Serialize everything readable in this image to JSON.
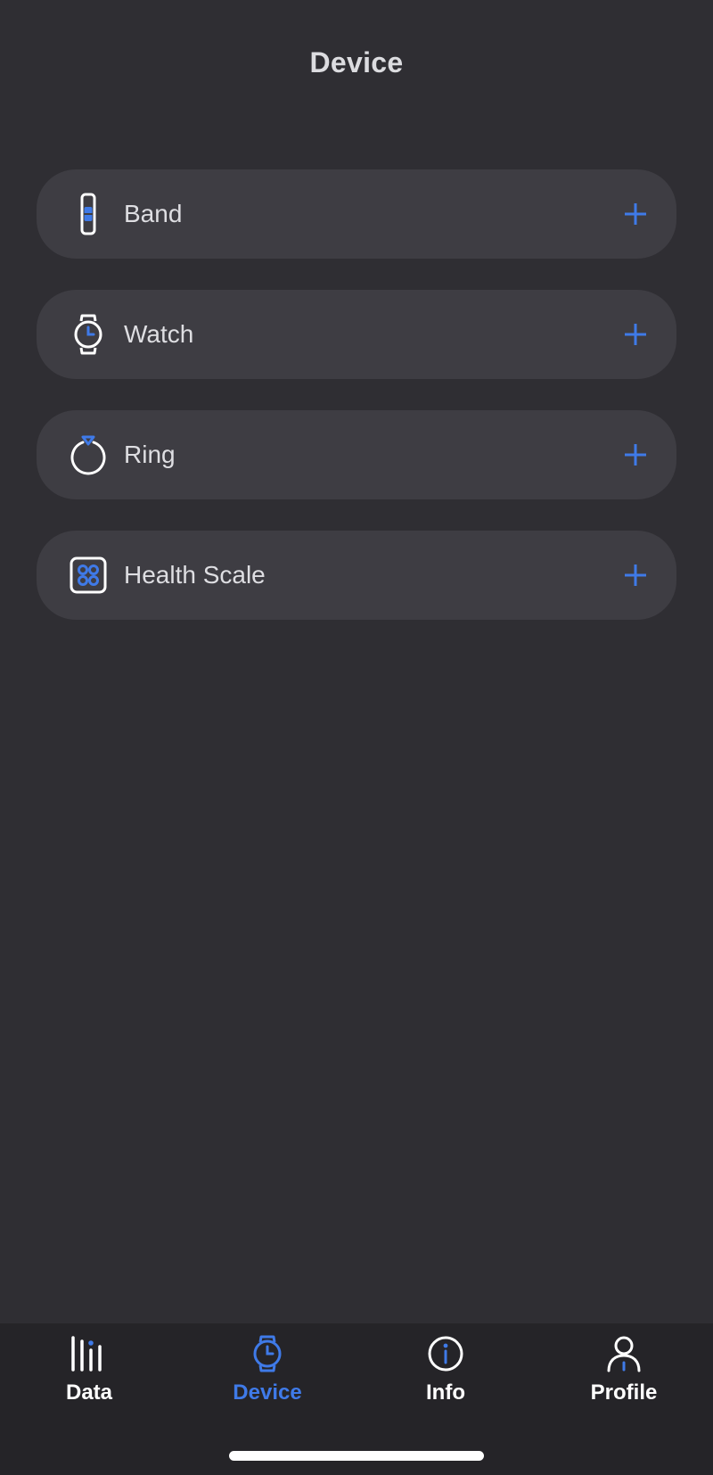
{
  "header": {
    "title": "Device"
  },
  "devices": [
    {
      "label": "Band",
      "icon": "band-icon",
      "action": "+"
    },
    {
      "label": "Watch",
      "icon": "watch-icon",
      "action": "+"
    },
    {
      "label": "Ring",
      "icon": "ring-icon",
      "action": "+"
    },
    {
      "label": "Health Scale",
      "icon": "health-scale-icon",
      "action": "+"
    }
  ],
  "tabs": [
    {
      "label": "Data",
      "icon": "data-bars-icon",
      "active": false
    },
    {
      "label": "Device",
      "icon": "watch-icon",
      "active": true
    },
    {
      "label": "Info",
      "icon": "info-icon",
      "active": false
    },
    {
      "label": "Profile",
      "icon": "profile-icon",
      "active": false
    }
  ],
  "colors": {
    "background": "#2f2e33",
    "card": "#3e3d43",
    "accent": "#3f7ae8",
    "tab_bar": "#252428"
  }
}
